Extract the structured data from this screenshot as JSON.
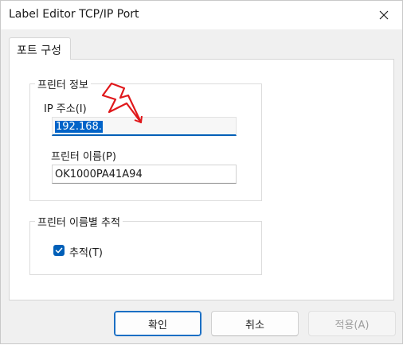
{
  "window": {
    "title": "Label Editor TCP/IP Port",
    "close_icon": "close-icon"
  },
  "tab": {
    "label": "포트 구성"
  },
  "printer_info": {
    "group_label": "프린터 정보",
    "ip_label": "IP 주소(I)",
    "ip_value": "192.168.",
    "name_label": "프린터 이름(P)",
    "name_value": "OK1000PA41A94"
  },
  "tracking": {
    "group_label": "프린터 이름별 추적",
    "checkbox_label": "추적(T)",
    "checked": true
  },
  "buttons": {
    "ok": "확인",
    "cancel": "취소",
    "apply": "적용(A)"
  },
  "annotation": {
    "type": "red-lightning-arrow",
    "color": "#e0181b"
  }
}
